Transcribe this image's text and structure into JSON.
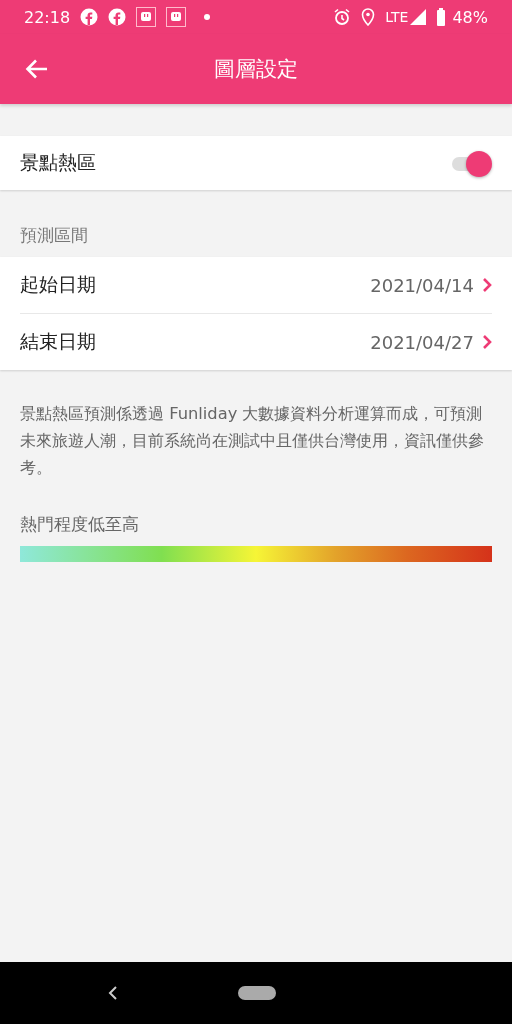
{
  "status_bar": {
    "time": "22:18",
    "network": "LTE",
    "battery": "48%"
  },
  "header": {
    "title": "圖層設定"
  },
  "hotspot_toggle": {
    "label": "景點熱區",
    "on": true
  },
  "forecast_range": {
    "section_label": "預測區間",
    "rows": [
      {
        "label": "起始日期",
        "value": "2021/04/14"
      },
      {
        "label": "結束日期",
        "value": "2021/04/27"
      }
    ]
  },
  "note": "景點熱區預測係透過 Funliday 大數據資料分析運算而成，可預測未來旅遊人潮，目前系統尚在測試中且僅供台灣使用，資訊僅供參考。",
  "legend": {
    "label": "熱門程度低至高"
  }
}
